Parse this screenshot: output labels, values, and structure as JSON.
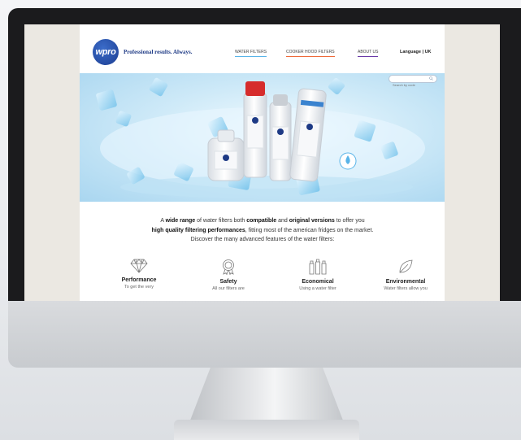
{
  "header": {
    "logo_text": "wpro",
    "tagline": "Professional results. Always.",
    "nav": [
      {
        "label": "WATER FILTERS"
      },
      {
        "label": "COOKER HOOD FILTERS"
      },
      {
        "label": "ABOUT US"
      }
    ],
    "language_label": "Language | UK",
    "search_placeholder": "Search by code"
  },
  "intro": {
    "line1_a": "A ",
    "line1_b": "wide range",
    "line1_c": " of water filters both ",
    "line1_d": "compatible",
    "line1_e": " and ",
    "line1_f": "original versions",
    "line1_g": " to offer you",
    "line2_a": "high quality filtering performances",
    "line2_b": ", fitting most of the american fridges on the market.",
    "line3": "Discover the many advanced features of the water filters:"
  },
  "features": [
    {
      "icon": "diamond-icon",
      "title": "Performance",
      "desc": "To get the very"
    },
    {
      "icon": "award-ribbon-icon",
      "title": "Safety",
      "desc": "All our filters are"
    },
    {
      "icon": "bottles-icon",
      "title": "Economical",
      "desc": "Using a water filter"
    },
    {
      "icon": "leaf-icon",
      "title": "Environmental",
      "desc": "Water filters allow you"
    }
  ],
  "colors": {
    "brand_blue": "#1e3a85",
    "nav_water": "#59b4e8",
    "nav_cooker": "#ee6a3a",
    "nav_about": "#6a3aa8"
  }
}
